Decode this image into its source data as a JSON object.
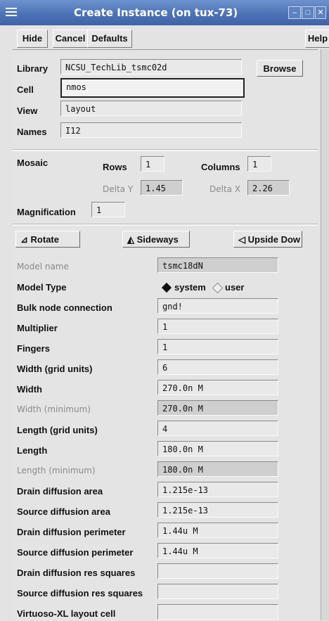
{
  "window": {
    "title": "Create Instance (on tux-73)"
  },
  "toolbar": {
    "hide": "Hide",
    "cancel": "Cancel",
    "defaults": "Defaults",
    "help": "Help"
  },
  "fields": {
    "library": {
      "label": "Library",
      "value": "NCSU_TechLib_tsmc02d",
      "browse": "Browse"
    },
    "cell": {
      "label": "Cell",
      "value": "nmos"
    },
    "view": {
      "label": "View",
      "value": "layout"
    },
    "names": {
      "label": "Names",
      "value": "I12"
    }
  },
  "mosaic": {
    "label": "Mosaic",
    "rows_label": "Rows",
    "rows": "1",
    "columns_label": "Columns",
    "columns": "1",
    "delta_y_label": "Delta Y",
    "delta_y": "1.45",
    "delta_x_label": "Delta X",
    "delta_x": "2.26"
  },
  "magnification": {
    "label": "Magnification",
    "value": "1"
  },
  "transform": {
    "rotate": "Rotate",
    "sideways": "Sideways",
    "upside_down": "Upside Dow"
  },
  "params": [
    {
      "label": "Model name",
      "value": "tsmc18dN",
      "dim": true,
      "ro": true
    },
    {
      "label": "Model Type",
      "radio": true,
      "opt1": "system",
      "opt2": "user",
      "selected": "system"
    },
    {
      "label": "Bulk node connection",
      "value": "gnd!"
    },
    {
      "label": "Multiplier",
      "value": "1"
    },
    {
      "label": "Fingers",
      "value": "1"
    },
    {
      "label": "Width (grid units)",
      "value": "6"
    },
    {
      "label": "Width",
      "value": "270.0n M"
    },
    {
      "label": "Width (minimum)",
      "value": "270.0n M",
      "dim": true,
      "ro": true
    },
    {
      "label": "Length (grid units)",
      "value": "4"
    },
    {
      "label": "Length",
      "value": "180.0n M"
    },
    {
      "label": "Length (minimum)",
      "value": "180.0n M",
      "dim": true,
      "ro": true
    },
    {
      "label": "Drain diffusion area",
      "value": "1.215e-13"
    },
    {
      "label": "Source diffusion area",
      "value": "1.215e-13"
    },
    {
      "label": "Drain diffusion perimeter",
      "value": "1.44u M"
    },
    {
      "label": "Source diffusion perimeter",
      "value": "1.44u M"
    },
    {
      "label": "Drain diffusion res squares",
      "value": ""
    },
    {
      "label": "Source diffusion res squares",
      "value": ""
    },
    {
      "label": "Virtuoso-XL layout cell",
      "value": ""
    }
  ]
}
